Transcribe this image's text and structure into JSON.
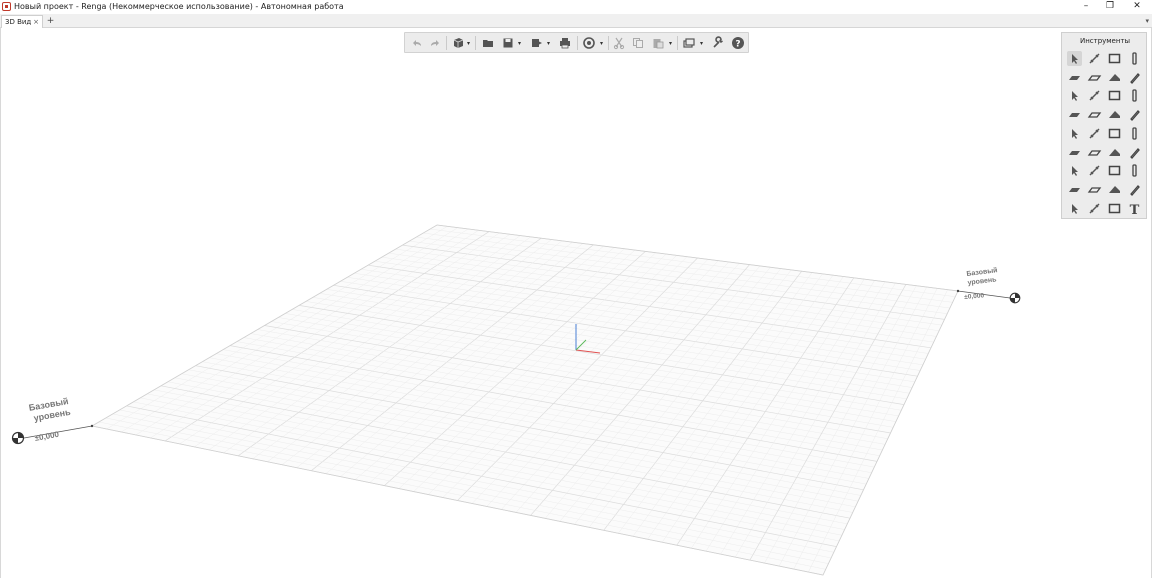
{
  "window": {
    "title": "Новый проект - Renga (Некоммерческое использование) - Автономная работа",
    "min_glyph": "–",
    "restore_glyph": "❐",
    "close_glyph": "✕"
  },
  "tabs": [
    {
      "label": "3D Вид",
      "close_glyph": "×"
    }
  ],
  "tab_add_glyph": "+",
  "tab_menu_glyph": "▾",
  "toolbar": {
    "buttons": [
      "undo-icon",
      "redo-icon",
      "view-cube-icon",
      "open-folder-icon",
      "save-icon",
      "export-icon",
      "print-icon",
      "visibility-icon",
      "cut-icon",
      "copy-icon",
      "paste-icon",
      "layers-icon",
      "settings-wrench-icon",
      "help-icon"
    ]
  },
  "tools_panel": {
    "title": "Инструменты",
    "icons": [
      "select-icon",
      "dimension-icon",
      "rectangle-icon",
      "column-icon",
      "slab-icon",
      "floor-icon",
      "roof-icon",
      "pen-icon",
      "stairs-icon",
      "ramp-icon",
      "door-icon",
      "window-icon",
      "beam-icon",
      "line-icon",
      "pipe-fitting-icon",
      "duct-icon",
      "equipment-icon",
      "panel-icon",
      "shield-icon",
      "valve-icon",
      "pump-icon",
      "fan-icon",
      "fitting-icon",
      "boiler-icon",
      "tank-icon",
      "hood-icon",
      "sink-icon",
      "accessory-icon",
      "cabinet-icon",
      "plumbing-icon",
      "device-icon",
      "connector-icon",
      "annotation-icon",
      "leader-icon",
      "tag-icon",
      "text-icon"
    ]
  },
  "levels": [
    {
      "name": "Базовый уровень",
      "elevation": "±0,000",
      "line1": "Базовый",
      "line2": "уровень"
    },
    {
      "name": "Базовый уровень",
      "elevation": "±0,000",
      "line1": "Базовый",
      "line2": "уровень"
    }
  ],
  "colors": {
    "grid_minor": "#ececec",
    "grid_major": "#dcdcdc",
    "axis_x": "#e05050",
    "axis_y": "#5cb85c",
    "axis_z": "#4a7fd4"
  }
}
